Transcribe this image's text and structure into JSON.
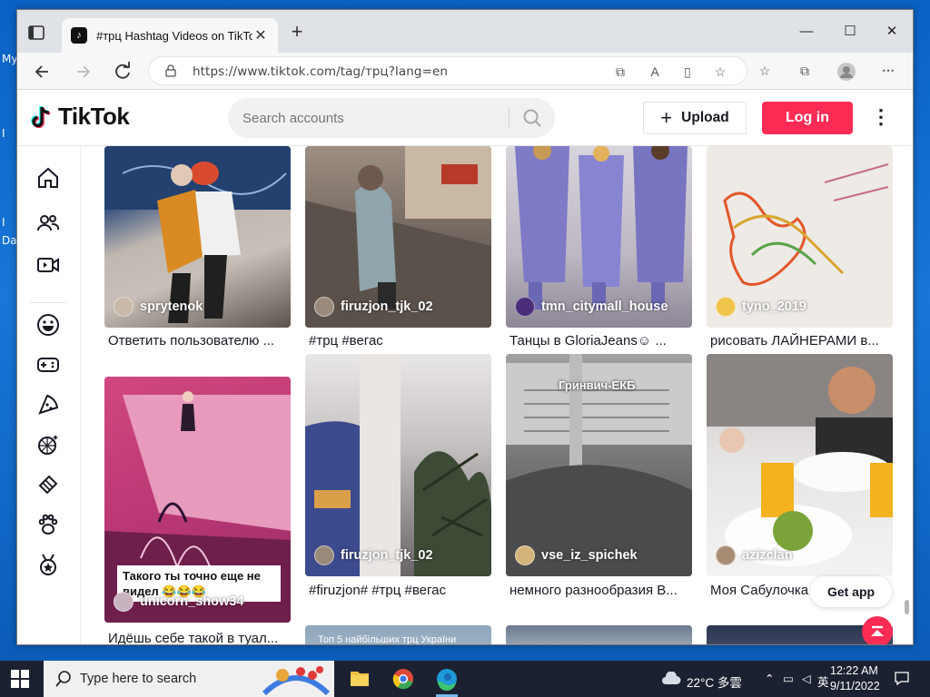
{
  "desktop": {
    "labels": [
      "My",
      "I",
      "I",
      "Da"
    ]
  },
  "browser": {
    "tab": {
      "title": "#трц Hashtag Videos on TikTok",
      "close": "✕"
    },
    "new_tab": "+",
    "window_controls": {
      "minimize": "—",
      "maximize": "☐",
      "close": "✕"
    },
    "url": "https://www.tiktok.com/tag/трц?lang=en"
  },
  "tiktok": {
    "brand": "TikTok",
    "search_placeholder": "Search accounts",
    "upload_label": "Upload",
    "login_label": "Log in",
    "more": "⋮",
    "get_app": "Get app",
    "sidebar_icons": [
      "home-icon",
      "following-icon",
      "live-icon",
      "comedy-icon",
      "gaming-icon",
      "food-icon",
      "dance-icon",
      "beauty-icon",
      "animals-icon",
      "sports-icon"
    ],
    "videos": [
      {
        "user": "sprytenok",
        "desc": "Ответить пользователю ..."
      },
      {
        "user": "firuzjon_tjk_02",
        "desc": "#трц #вегас"
      },
      {
        "user": "tmn_citymall_house",
        "desc": "Танцы в GloriaJeans☺ ..."
      },
      {
        "user": "tyno_2019",
        "desc": "рисовать ЛАЙНЕРАМИ в..."
      },
      {
        "user": "unicorn_show34",
        "desc": "Идёшь себе такой в туал...",
        "overlay": "Такого ты точно еще не видел 😂😂😂"
      },
      {
        "user": "firuzjon_tjk_02",
        "desc": "#firuzjon# #трц #вегас"
      },
      {
        "user": "vse_iz_spichek",
        "desc": "немного разнообразия В...",
        "overlay": "Гринвич-ЕКБ"
      },
      {
        "user": "azizclan",
        "desc": "Моя Сабулочка"
      }
    ],
    "row3_caption": "Топ 5 найбільших трц України"
  },
  "taskbar": {
    "search_placeholder": "Type here to search",
    "weather": "22°C 多雲",
    "lang": "英",
    "time": "12:22 AM",
    "date": "9/11/2022"
  }
}
